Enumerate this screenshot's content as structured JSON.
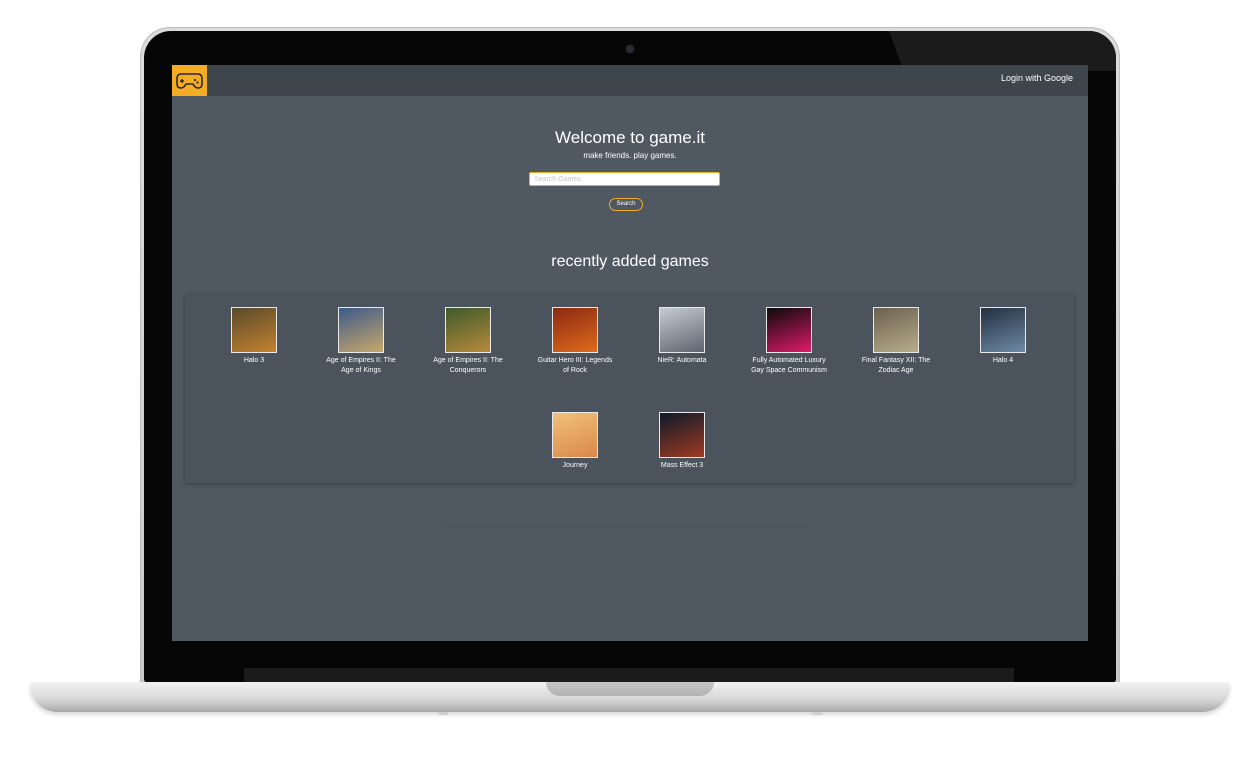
{
  "navbar": {
    "logo_icon": "gamepad-icon",
    "login_label": "Login with Google"
  },
  "hero": {
    "title": "Welcome to game.it",
    "subtitle": "make friends. play games.",
    "search_placeholder": "Search Games",
    "search_button": "Search"
  },
  "recent": {
    "heading": "recently added games",
    "games": [
      {
        "title": "Halo 3",
        "cover": "#5a4a2c",
        "cover2": "#c4822e"
      },
      {
        "title": "Age of Empires II: The Age of Kings",
        "cover": "#3d5a8a",
        "cover2": "#c7a86a"
      },
      {
        "title": "Age of Empires II: The Conquerors",
        "cover": "#3f5a2c",
        "cover2": "#b88a3a"
      },
      {
        "title": "Guitar Hero III: Legends of Rock",
        "cover": "#8a2a12",
        "cover2": "#e06a1c"
      },
      {
        "title": "NieR: Automata",
        "cover": "#c6cbd2",
        "cover2": "#5d6470"
      },
      {
        "title": "Fully Automated Luxury Gay Space Communism",
        "cover": "#0a0a0a",
        "cover2": "#e01a6a"
      },
      {
        "title": "Final Fantasy XII: The Zodiac Age",
        "cover": "#6a6250",
        "cover2": "#b8ac8a"
      },
      {
        "title": "Halo 4",
        "cover": "#23303f",
        "cover2": "#6d8aa6"
      },
      {
        "title": "Journey",
        "cover": "#f3c27a",
        "cover2": "#d9874a"
      },
      {
        "title": "Mass Effect 3",
        "cover": "#0d1a2a",
        "cover2": "#a03a22"
      }
    ]
  },
  "colors": {
    "accent": "#f4ac25",
    "background": "#505962",
    "navbar": "#3e454b",
    "panel": "#4b545c"
  }
}
